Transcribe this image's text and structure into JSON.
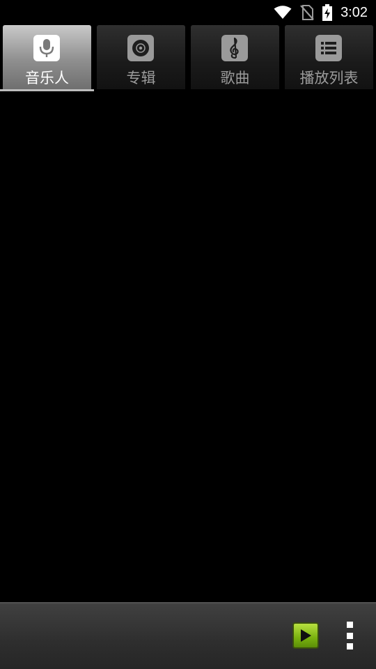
{
  "status_bar": {
    "time": "3:02",
    "icons": [
      "wifi-icon",
      "no-sim-icon",
      "battery-charging-icon"
    ]
  },
  "tabs": [
    {
      "label": "音乐人",
      "icon": "microphone-icon",
      "selected": true
    },
    {
      "label": "专辑",
      "icon": "album-disc-icon",
      "selected": false
    },
    {
      "label": "歌曲",
      "icon": "treble-clef-icon",
      "selected": false
    },
    {
      "label": "播放列表",
      "icon": "playlist-icon",
      "selected": false
    }
  ],
  "bottom_bar": {
    "play_icon": "play-icon",
    "menu_icon": "overflow-menu-icon"
  },
  "colors": {
    "accent_play": "#79b10f",
    "background": "#000000"
  }
}
